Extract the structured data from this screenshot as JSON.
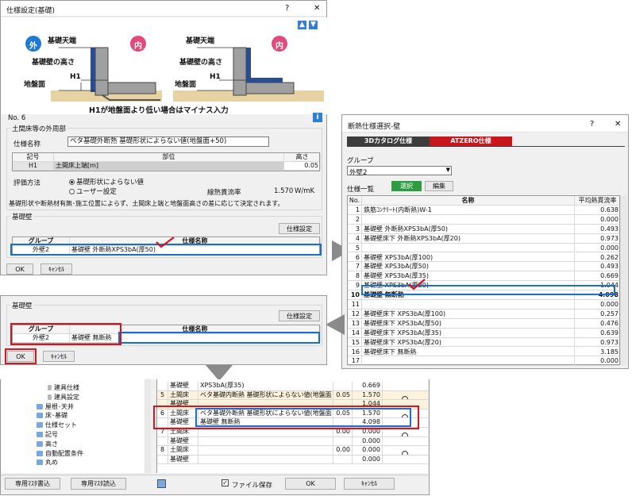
{
  "win1": {
    "title": "仕様設定(基礎)",
    "help": "?",
    "close": "✕",
    "label_out": "外",
    "label_in": "内",
    "d_top": "基礎天端",
    "d_wall": "基礎壁の高さ",
    "d_ground": "地盤面",
    "d_h1": "H1",
    "caption": "H1が地盤面より低い場合はマイナス入力",
    "no": "No.  6",
    "info": "i",
    "group1": "土間床等の外周部",
    "name_label": "仕様名称",
    "name_value": "ベタ基礎外断熱 基礎形状によらない値(地盤面+50)",
    "col_code": "記号",
    "col_part": "部位",
    "col_height": "高さ",
    "r_code": "H1",
    "r_part": "土間床上端[m]",
    "r_height": "0.05",
    "eval_label": "評価方法",
    "radio1": "基礎形状によらない値",
    "radio2": "ユーザー設定",
    "psi_label": "線熱貫流率",
    "psi_value": "1.570",
    "psi_unit": "W/mK",
    "note": "基礎形状や断熱材有無･施工位置によらず、土間床上端と地盤面高さの差に応じて決定されます。",
    "group2": "基礎壁",
    "spec_btn": "仕様設定",
    "col_group": "グループ",
    "col_spec": "仕様名称",
    "g_value": "外壁2",
    "s_value": "基礎壁 外断熱XPS3bA(厚50)",
    "ok": "OK",
    "cancel": "ｷｬﾝｾﾙ"
  },
  "win2": {
    "group": "基礎壁",
    "spec_btn": "仕様設定",
    "col_group": "グループ",
    "col_spec": "仕様名称",
    "g_value": "外壁2",
    "s_value": "基礎壁 無断熱",
    "ok": "OK",
    "cancel": "ｷｬﾝｾﾙ"
  },
  "win3": {
    "title": "断熱仕様選択-壁",
    "help": "?",
    "close": "✕",
    "tab1": "3Dカタログ仕様",
    "tab2": "ATZERO仕様",
    "group_label": "グループ",
    "group_value": "外壁2",
    "list_label": "仕様一覧",
    "select_btn": "選択",
    "edit_btn": "編集",
    "col_no": "No.",
    "col_name": "名称",
    "col_u": "平均熱貫流率",
    "rows": [
      {
        "no": "1",
        "name": "鉄筋ｺﾝｸﾘｰﾄ(内断熱)W-1",
        "u": "0.638"
      },
      {
        "no": "2",
        "name": "",
        "u": "0.000"
      },
      {
        "no": "3",
        "name": "基礎壁 外断熱XPS3bA(厚50)",
        "u": "0.493"
      },
      {
        "no": "4",
        "name": "基礎壁床下 外断熱XPS3bA(厚20)",
        "u": "0.973"
      },
      {
        "no": "5",
        "name": "",
        "u": "0.000"
      },
      {
        "no": "6",
        "name": "基礎壁 XPS3bA(厚100)",
        "u": "0.262"
      },
      {
        "no": "7",
        "name": "基礎壁 XPS3bA(厚50)",
        "u": "0.493"
      },
      {
        "no": "8",
        "name": "基礎壁 XPS3bA(厚35)",
        "u": "0.669"
      },
      {
        "no": "9",
        "name": "基礎壁 XPS3bA(厚20)",
        "u": "1.044"
      },
      {
        "no": "10",
        "name": "基礎壁 無断熱",
        "u": "4.098"
      },
      {
        "no": "11",
        "name": "",
        "u": "0.000"
      },
      {
        "no": "12",
        "name": "基礎壁床下 XPS3bA(厚100)",
        "u": "0.257"
      },
      {
        "no": "13",
        "name": "基礎壁床下 XPS3bA(厚50)",
        "u": "0.476"
      },
      {
        "no": "14",
        "name": "基礎壁床下 XPS3bA(厚35)",
        "u": "0.639"
      },
      {
        "no": "15",
        "name": "基礎壁床下 XPS3bA(厚20)",
        "u": "0.973"
      },
      {
        "no": "16",
        "name": "基礎壁床下 無断熱",
        "u": "3.185"
      },
      {
        "no": "17",
        "name": "",
        "u": "0.000"
      }
    ]
  },
  "win4": {
    "tree": [
      "建具仕様",
      "建具設定",
      "屋根･天井",
      "床･基礎",
      "仕様セット",
      "記号",
      "高さ",
      "自動配置条件",
      "丸め"
    ],
    "rows": [
      {
        "no": "",
        "a": "基礎壁",
        "b": "XPS3bA(厚35)",
        "h": "",
        "v": "0.669",
        "o": false
      },
      {
        "no": "5",
        "a": "土間床",
        "b": "ベタ基礎内断熱 基礎形状によらない値(地盤面",
        "h": "0.05",
        "v": "1.570",
        "o": true
      },
      {
        "no": "",
        "a": "基礎壁",
        "b": "",
        "h": "",
        "v": "1.044",
        "o": false
      },
      {
        "no": "6",
        "a": "土間床",
        "b": "ベタ基礎外断熱 基礎形状によらない値(地盤面",
        "h": "0.05",
        "v": "1.570",
        "o": true
      },
      {
        "no": "",
        "a": "基礎壁",
        "b": "基礎壁 無断熱",
        "h": "",
        "v": "4.098",
        "o": false
      },
      {
        "no": "7",
        "a": "土間床",
        "b": "",
        "h": "0.00",
        "v": "0.000",
        "o": true
      },
      {
        "no": "",
        "a": "基礎壁",
        "b": "",
        "h": "",
        "v": "0.000",
        "o": false
      },
      {
        "no": "8",
        "a": "土間床",
        "b": "",
        "h": "0.00",
        "v": "0.000",
        "o": true
      },
      {
        "no": "",
        "a": "基礎壁",
        "b": "",
        "h": "",
        "v": "0.000",
        "o": false
      }
    ],
    "btn_write": "専用ﾏｽﾀ書込",
    "btn_read": "専用ﾏｽﾀ読込",
    "file_save": "ファイル保存",
    "ok": "OK",
    "cancel": "ｷｬﾝｾﾙ"
  },
  "colors": {
    "hl_red": "#d7141f",
    "hl_blue": "#1c6fc9",
    "tab_red": "#c8161d",
    "btn_green": "#2e9d3f",
    "arrow": "#8a8a8a"
  }
}
